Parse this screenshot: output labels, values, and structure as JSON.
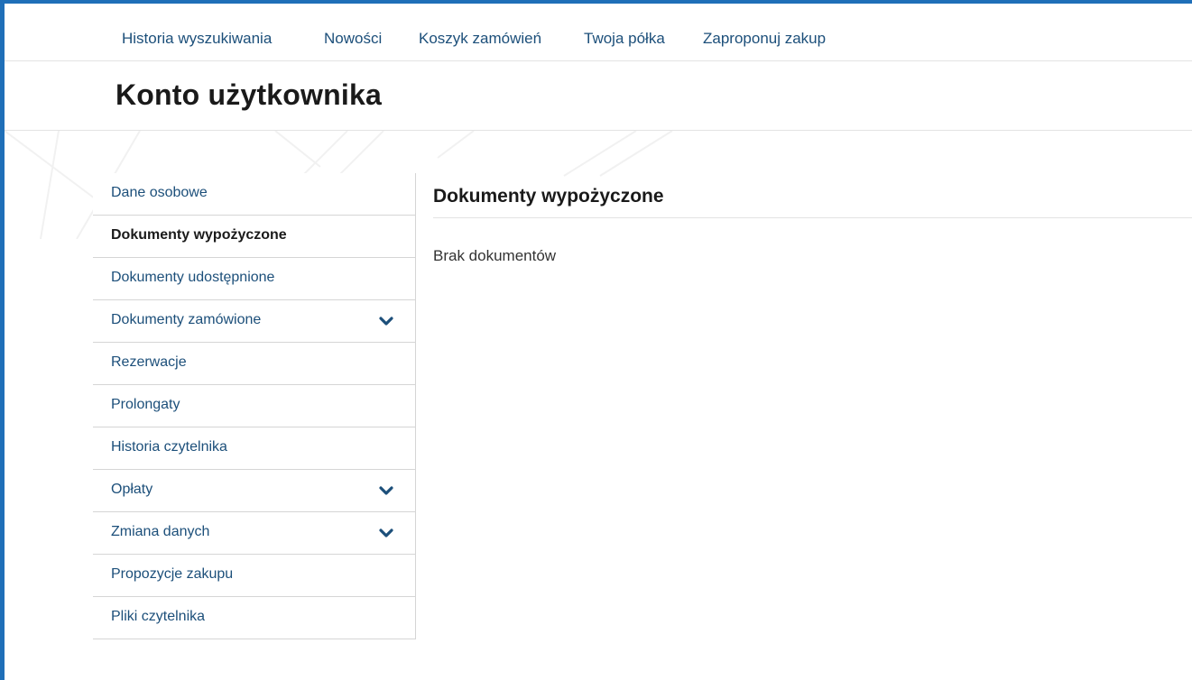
{
  "topnav": {
    "items": [
      {
        "label": "Historia wyszukiwania"
      },
      {
        "label": "Nowości"
      },
      {
        "label": "Koszyk zamówień"
      },
      {
        "label": "Twoja półka"
      },
      {
        "label": "Zaproponuj zakup"
      }
    ]
  },
  "header": {
    "title": "Konto użytkownika"
  },
  "sidebar": {
    "active_index": 1,
    "items": [
      {
        "label": "Dane osobowe",
        "has_submenu": false
      },
      {
        "label": "Dokumenty wypożyczone",
        "has_submenu": false
      },
      {
        "label": "Dokumenty udostępnione",
        "has_submenu": false
      },
      {
        "label": "Dokumenty zamówione",
        "has_submenu": true,
        "icon": "chevron-down-icon"
      },
      {
        "label": "Rezerwacje",
        "has_submenu": false
      },
      {
        "label": "Prolongaty",
        "has_submenu": false
      },
      {
        "label": "Historia czytelnika",
        "has_submenu": false
      },
      {
        "label": "Opłaty",
        "has_submenu": true,
        "icon": "chevron-down-icon"
      },
      {
        "label": "Zmiana danych",
        "has_submenu": true,
        "icon": "chevron-down-icon"
      },
      {
        "label": "Propozycje zakupu",
        "has_submenu": false
      },
      {
        "label": "Pliki czytelnika",
        "has_submenu": false
      }
    ]
  },
  "main": {
    "section_title": "Dokumenty wypożyczone",
    "empty_message": "Brak dokumentów"
  },
  "colors": {
    "accent": "#1f6fb8",
    "link": "#1c4f7a",
    "border": "#d5d5d5"
  }
}
